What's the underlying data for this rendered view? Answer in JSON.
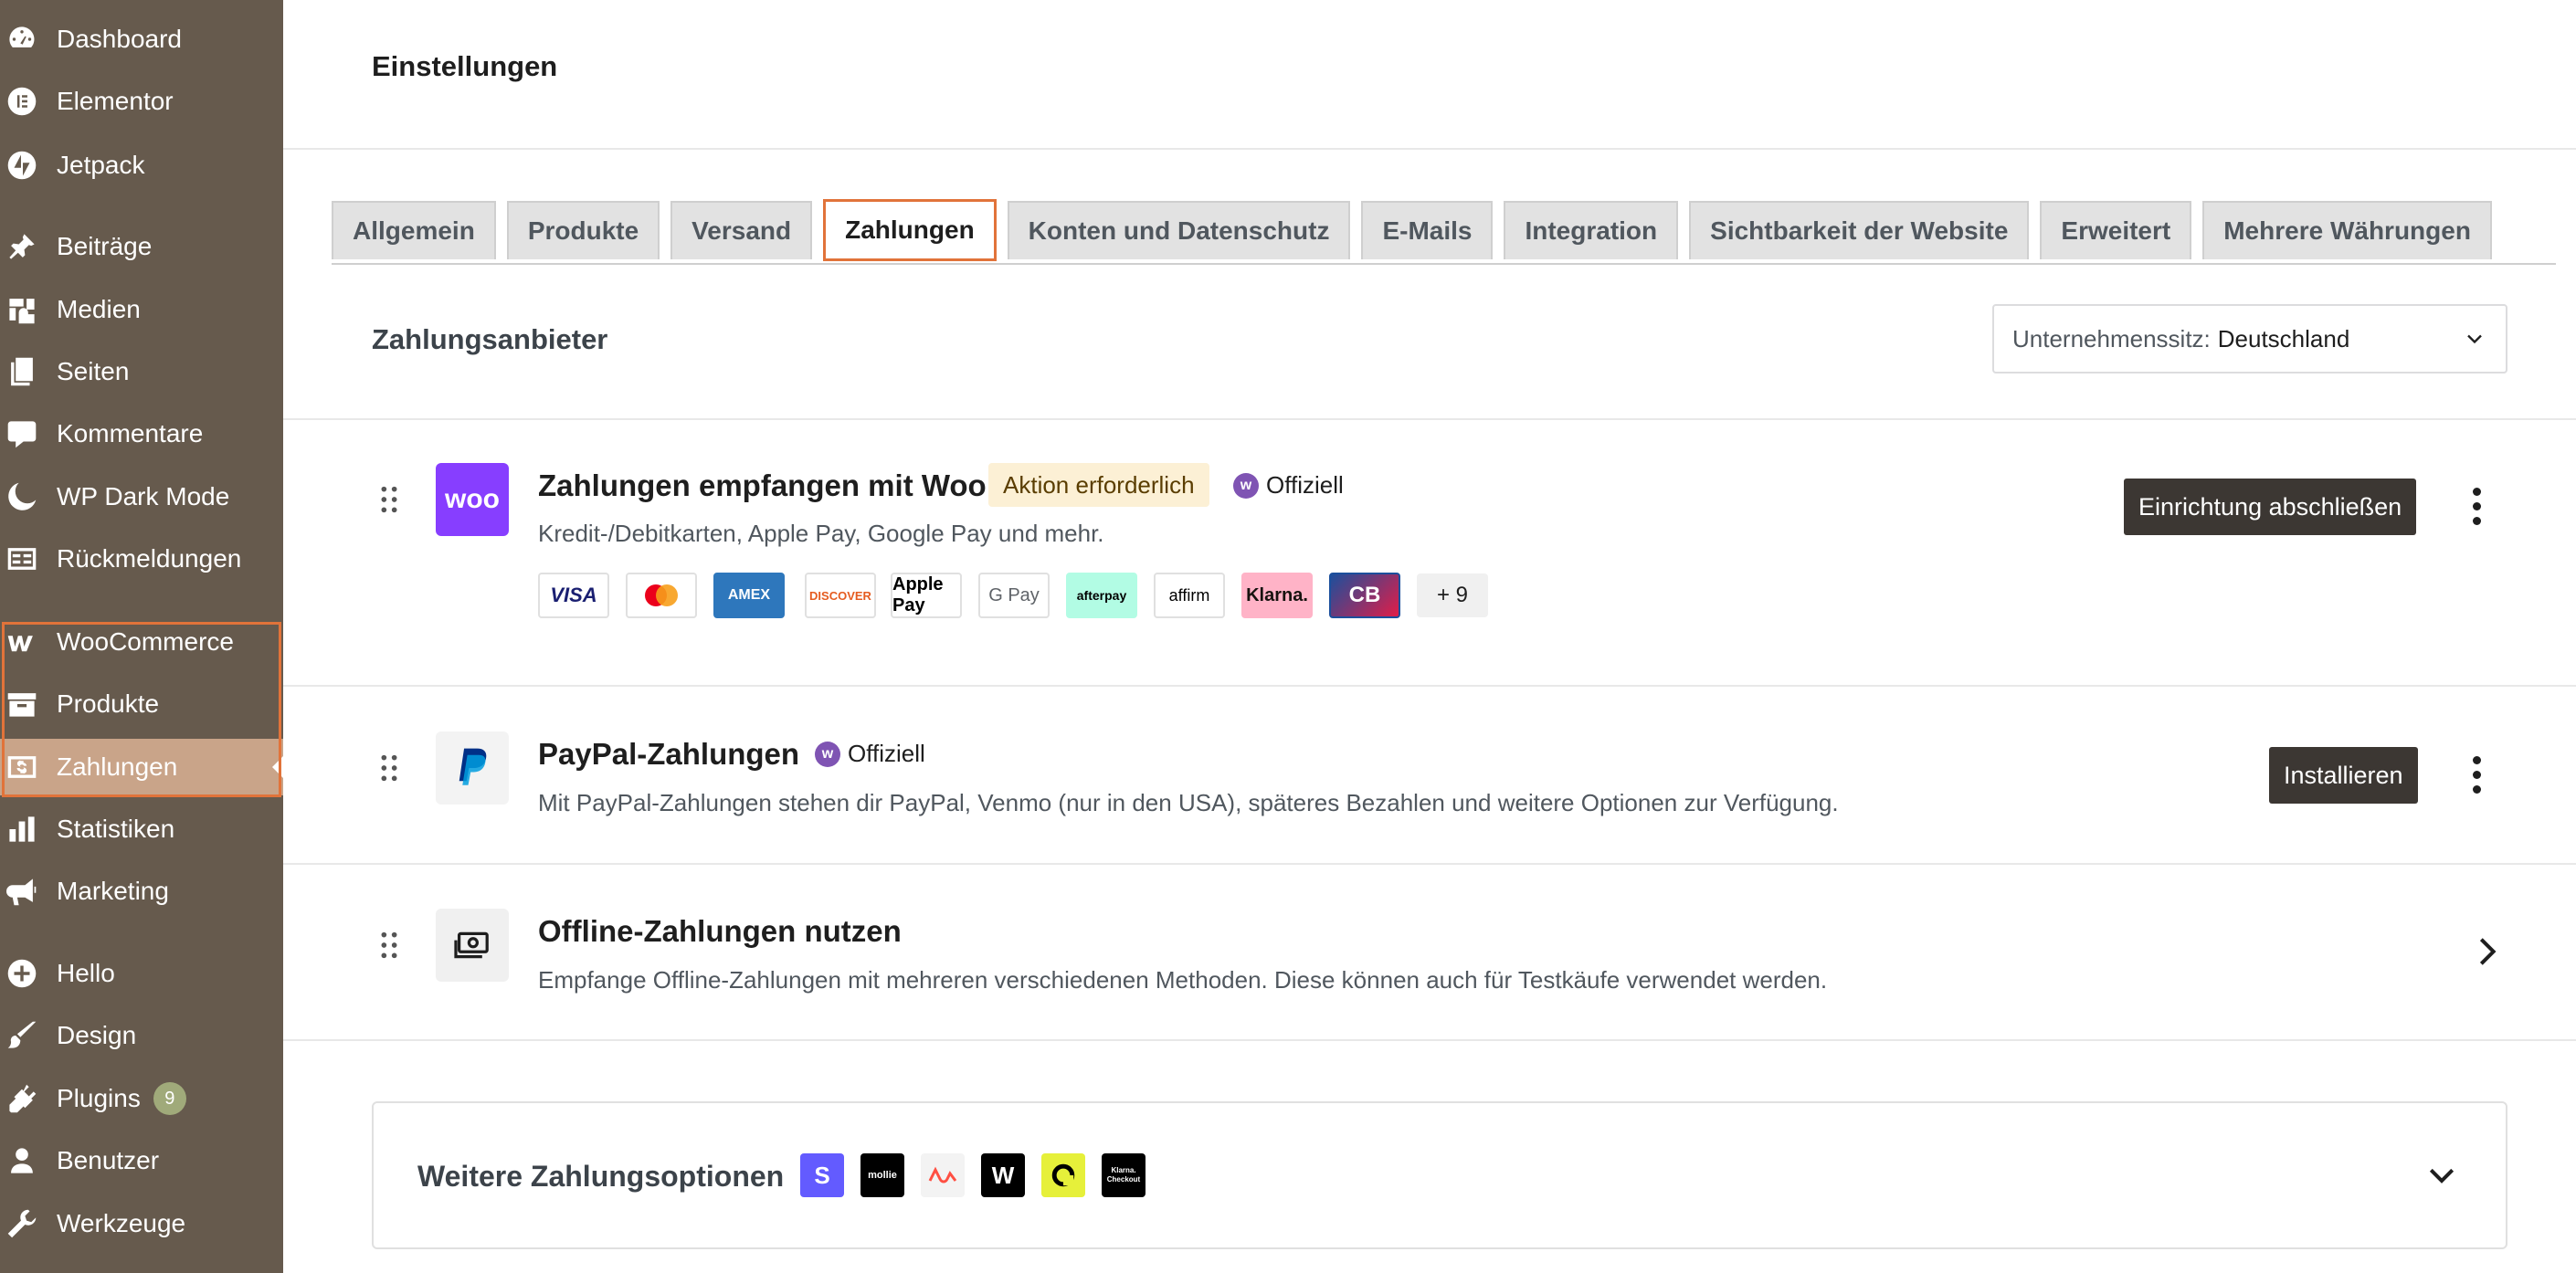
{
  "sidebar": {
    "items": [
      {
        "label": "Dashboard",
        "icon": "dashboard-icon"
      },
      {
        "label": "Elementor",
        "icon": "elementor-icon"
      },
      {
        "label": "Jetpack",
        "icon": "jetpack-icon"
      },
      {
        "label": "Beiträge",
        "icon": "pin-icon"
      },
      {
        "label": "Medien",
        "icon": "media-icon"
      },
      {
        "label": "Seiten",
        "icon": "pages-icon"
      },
      {
        "label": "Kommentare",
        "icon": "comments-icon"
      },
      {
        "label": "WP Dark Mode",
        "icon": "moon-icon"
      },
      {
        "label": "Rückmeldungen",
        "icon": "feedback-icon"
      },
      {
        "label": "WooCommerce",
        "icon": "woocommerce-icon"
      },
      {
        "label": "Produkte",
        "icon": "archive-icon"
      },
      {
        "label": "Zahlungen",
        "icon": "payments-icon",
        "active": true
      },
      {
        "label": "Statistiken",
        "icon": "bar-chart-icon"
      },
      {
        "label": "Marketing",
        "icon": "megaphone-icon"
      },
      {
        "label": "Hello",
        "icon": "plus-circle-icon"
      },
      {
        "label": "Design",
        "icon": "brush-icon"
      },
      {
        "label": "Plugins",
        "icon": "plugin-icon",
        "badge": "9"
      },
      {
        "label": "Benutzer",
        "icon": "user-icon"
      },
      {
        "label": "Werkzeuge",
        "icon": "wrench-icon"
      }
    ]
  },
  "page": {
    "title": "Einstellungen"
  },
  "tabs": [
    {
      "label": "Allgemein"
    },
    {
      "label": "Produkte"
    },
    {
      "label": "Versand"
    },
    {
      "label": "Zahlungen",
      "active": true
    },
    {
      "label": "Konten und Datenschutz"
    },
    {
      "label": "E-Mails"
    },
    {
      "label": "Integration"
    },
    {
      "label": "Sichtbarkeit der Website"
    },
    {
      "label": "Erweitert"
    },
    {
      "label": "Mehrere Währungen"
    }
  ],
  "section": {
    "title": "Zahlungsanbieter",
    "location_label": "Unternehmenssitz:",
    "location_value": "Deutschland"
  },
  "providers": {
    "woo": {
      "logo_text": "woo",
      "title": "Zahlungen empfangen mit Woo",
      "badge": "Aktion erforderlich",
      "official": "Offiziell",
      "description": "Kredit-/Debitkarten, Apple Pay, Google Pay und mehr.",
      "button": "Einrichtung abschließen",
      "methods": [
        "VISA",
        "Mastercard",
        "AMEX",
        "DISCOVER",
        "Apple Pay",
        "G Pay",
        "afterpay",
        "affirm",
        "Klarna.",
        "CB"
      ],
      "more": "+ 9"
    },
    "paypal": {
      "title": "PayPal-Zahlungen",
      "official": "Offiziell",
      "description": "Mit PayPal-Zahlungen stehen dir PayPal, Venmo (nur in den USA), späteres Bezahlen und weitere Optionen zur Verfügung.",
      "button": "Installieren"
    },
    "offline": {
      "title": "Offline-Zahlungen nutzen",
      "description": "Empfange Offline-Zahlungen mit mehreren verschiedenen Methoden. Diese können auch für Testkäufe verwendet werden."
    }
  },
  "more_options": {
    "title": "Weitere Zahlungsoptionen",
    "logos": [
      "S",
      "mollie",
      "airwallex",
      "W",
      "payoneer",
      "Klarna. Checkout"
    ]
  },
  "colors": {
    "sidebar_bg": "#665a4d",
    "sidebar_active": "#c9a489",
    "accent_orange": "#e1733a",
    "woo_purple": "#7f54b3",
    "dark_button": "#3c3733"
  }
}
